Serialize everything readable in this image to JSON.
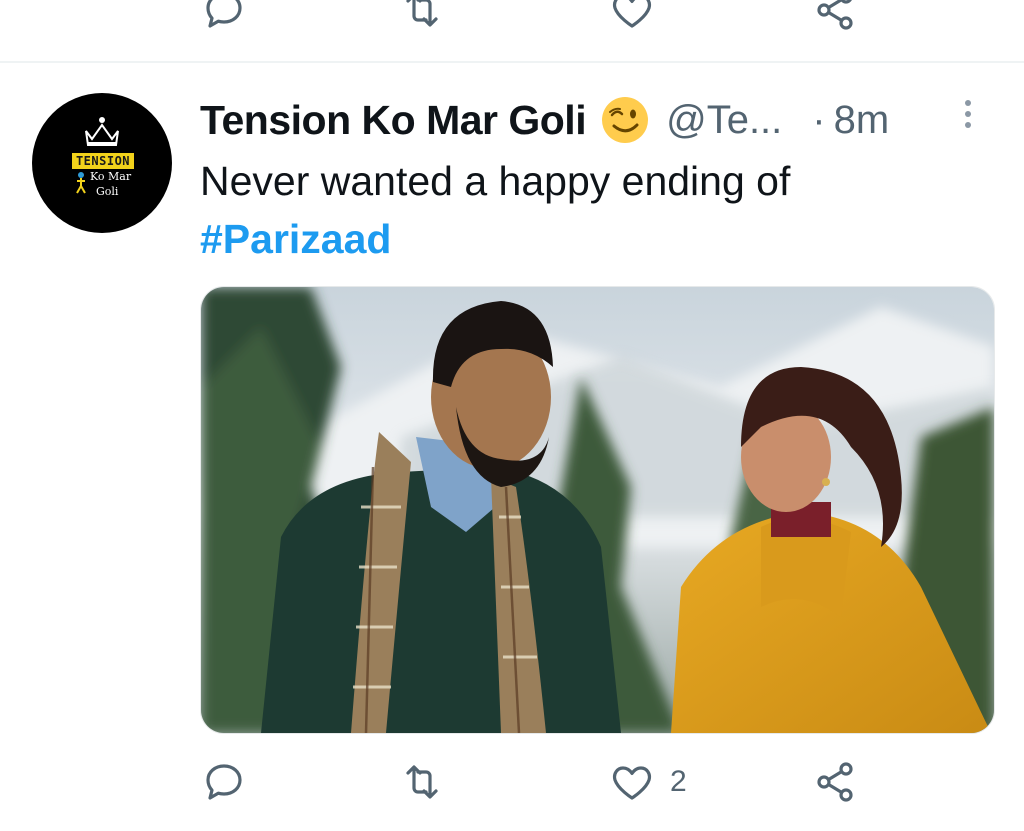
{
  "previous_tweet": {
    "actions": [
      {
        "name": "reply",
        "icon": "reply-icon"
      },
      {
        "name": "retweet",
        "icon": "retweet-icon"
      },
      {
        "name": "like",
        "icon": "heart-icon"
      },
      {
        "name": "share",
        "icon": "share-icon"
      }
    ]
  },
  "tweet": {
    "avatar": {
      "alt": "Tension Ko Mar Goli logo",
      "logo_text_line1": "TENSION",
      "logo_text_line2": "Ko Mar",
      "logo_text_line3": "Goli"
    },
    "display_name": "Tension Ko Mar Goli",
    "emoji": "winking-face-emoji",
    "handle": "@Te...",
    "separator": "·",
    "time": "8m",
    "text": "Never wanted a happy ending of",
    "hashtag": "#Parizaad",
    "media": {
      "alt": "A bearded man in a dark sweater and plaid scarf looks at a smiling woman in a mustard-yellow outfit and shawl, with snowy pine trees behind them"
    },
    "actions": {
      "reply_count": "",
      "retweet_count": "",
      "like_count": "2",
      "share_count": ""
    }
  },
  "colors": {
    "text_primary": "#0f1419",
    "text_secondary": "#536471",
    "link": "#1d9bf0",
    "divider": "#eff3f4"
  }
}
